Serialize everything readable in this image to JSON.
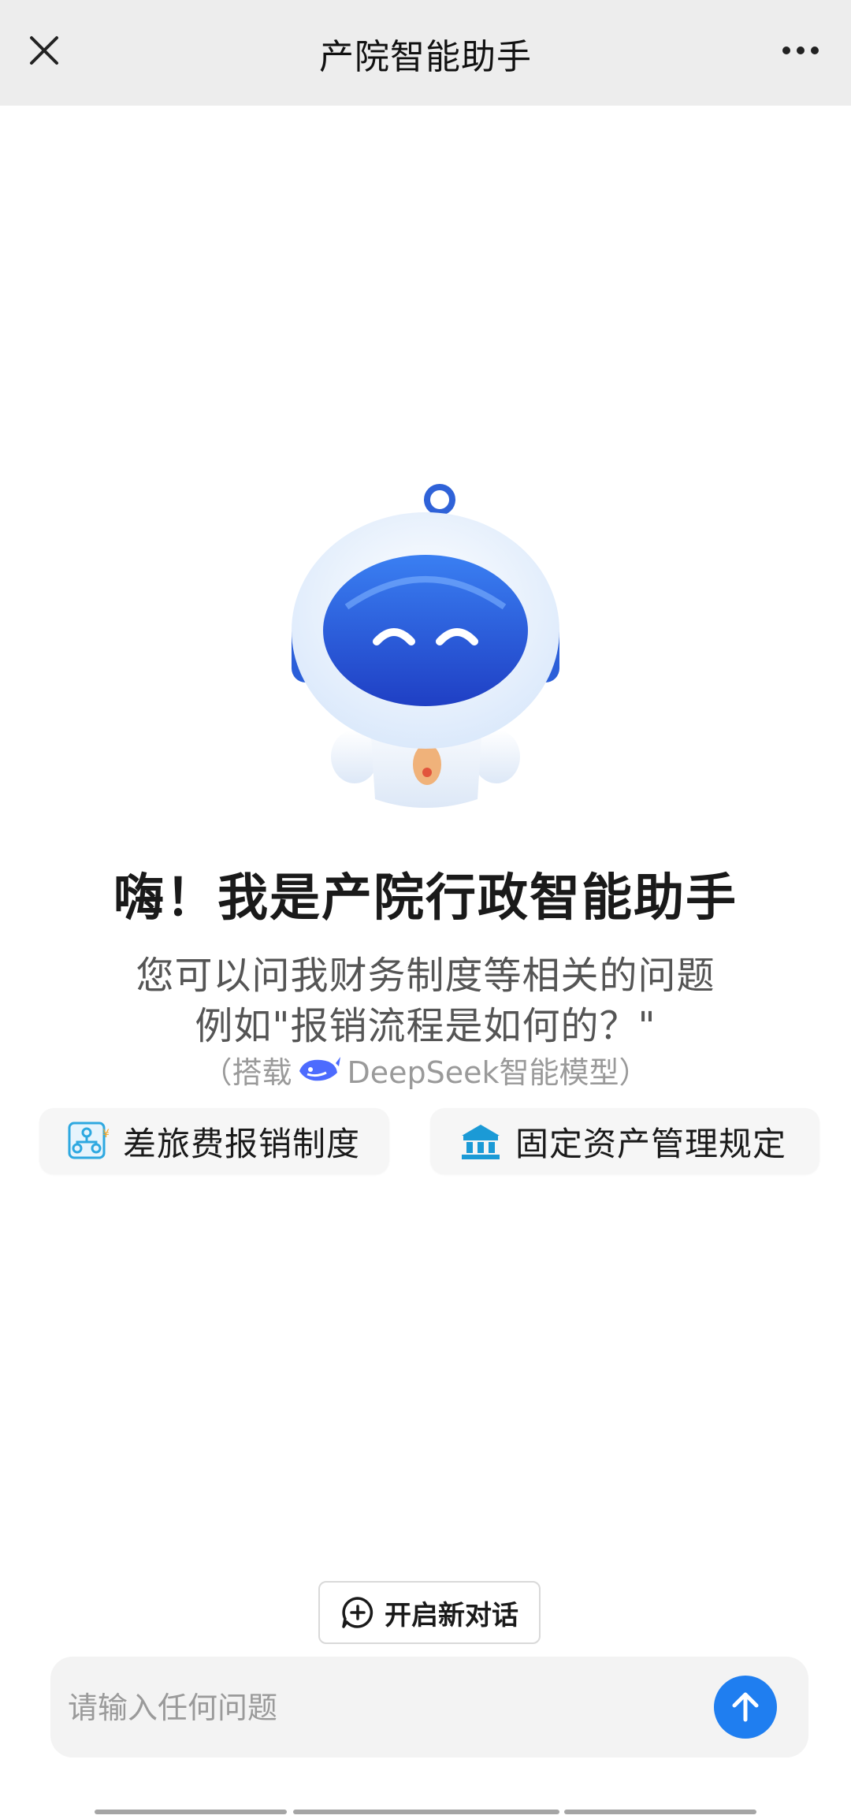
{
  "header": {
    "title": "产院智能助手",
    "close_icon": "close-icon",
    "more_icon": "more-icon"
  },
  "greeting": {
    "title": "嗨！我是产院行政智能助手",
    "line1": "您可以问我财务制度等相关的问题",
    "line2": "例如\"报销流程是如何的？\"",
    "model_prefix": "（搭载",
    "model_name": "DeepSeek智能模型",
    "model_suffix": "）"
  },
  "suggestions": [
    {
      "label": "差旅费报销制度",
      "icon": "org-chart-icon"
    },
    {
      "label": "固定资产管理规定",
      "icon": "building-icon"
    }
  ],
  "new_chat": {
    "label": "开启新对话",
    "icon": "chat-add-icon"
  },
  "input": {
    "placeholder": "请输入任何问题",
    "value": "",
    "send_icon": "arrow-up-icon"
  },
  "colors": {
    "accent": "#1f7ef0",
    "header_bg": "#ededed",
    "chip_bg": "#f6f6f6",
    "input_bg": "#f3f3f3"
  }
}
